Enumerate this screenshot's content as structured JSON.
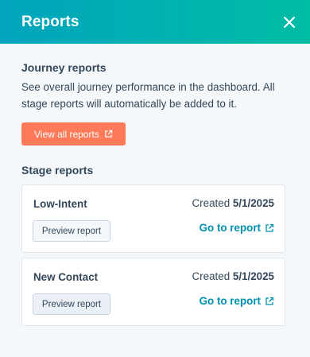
{
  "header": {
    "title": "Reports"
  },
  "journey": {
    "heading": "Journey reports",
    "description": "See overall journey performance in the dashboard. All stage reports will automatically be added to it.",
    "view_all_label": "View all reports"
  },
  "stage": {
    "heading": "Stage reports",
    "cards": [
      {
        "title": "Low-Intent",
        "created_prefix": "Created",
        "created_date": "5/1/2025",
        "preview_label": "Preview report",
        "go_label": "Go to report"
      },
      {
        "title": "New Contact",
        "created_prefix": "Created",
        "created_date": "5/1/2025",
        "preview_label": "Preview report",
        "go_label": "Go to report"
      }
    ]
  },
  "colors": {
    "header_start": "#00a4bd",
    "header_end": "#00bda5",
    "primary": "#ff7a59",
    "link": "#0091ae",
    "text": "#33475b"
  },
  "icons": {
    "close": "close-icon",
    "external": "external-link-icon"
  }
}
